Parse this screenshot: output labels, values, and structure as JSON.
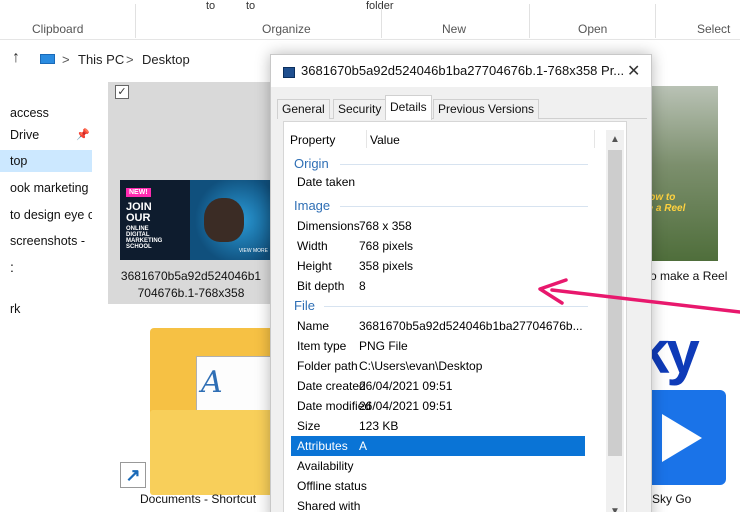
{
  "ribbon": {
    "top_texts": [
      "to",
      "to",
      "folder"
    ],
    "groups": [
      "Clipboard",
      "Organize",
      "New",
      "Open",
      "Select"
    ]
  },
  "address": {
    "crumbs": [
      "This PC",
      "Desktop"
    ],
    "separator": ">"
  },
  "nav": {
    "items": [
      "access",
      "Drive",
      "top",
      "ook marketing",
      "to design eye c",
      "screenshots -",
      "",
      "rk"
    ]
  },
  "files": {
    "selected_name_line1": "3681670b5a92d524046b1",
    "selected_name_line2": "704676b.1-768x358",
    "thumb_text": {
      "new": "NEW!",
      "join": "JOIN\nOUR",
      "small": "ONLINE\nDIGITAL\nMARKETING\nSCHOOL",
      "more": "VIEW MORE"
    },
    "right_thumb_text": "How to\nke a Reel",
    "right_name": "o make a Reel",
    "folder_name": "Documents - Shortcut",
    "sky_text": "ky",
    "skygo_name": "Sky Go"
  },
  "dialog": {
    "title": "3681670b5a92d524046b1ba27704676b.1-768x358 Pr...",
    "close_glyph": "✕",
    "tabs": [
      "General",
      "Security",
      "Details",
      "Previous Versions"
    ],
    "active_tab": "Details",
    "header": {
      "property": "Property",
      "value": "Value"
    },
    "groups": {
      "origin": "Origin",
      "image": "Image",
      "file": "File"
    },
    "origin_rows": [
      {
        "key": "Date taken",
        "value": ""
      }
    ],
    "image_rows": [
      {
        "key": "Dimensions",
        "value": "768 x 358"
      },
      {
        "key": "Width",
        "value": "768 pixels"
      },
      {
        "key": "Height",
        "value": "358 pixels"
      },
      {
        "key": "Bit depth",
        "value": "8"
      }
    ],
    "file_rows": [
      {
        "key": "Name",
        "value": "3681670b5a92d524046b1ba27704676b..."
      },
      {
        "key": "Item type",
        "value": "PNG File"
      },
      {
        "key": "Folder path",
        "value": "C:\\Users\\evan\\Desktop"
      },
      {
        "key": "Date created",
        "value": "26/04/2021 09:51"
      },
      {
        "key": "Date modified",
        "value": "26/04/2021 09:51"
      },
      {
        "key": "Size",
        "value": "123 KB"
      },
      {
        "key": "Attributes",
        "value": "A"
      },
      {
        "key": "Availability",
        "value": ""
      },
      {
        "key": "Offline status",
        "value": ""
      },
      {
        "key": "Shared with",
        "value": ""
      }
    ],
    "selected_row": "Attributes"
  },
  "colors": {
    "selection": "#0a74d6",
    "group_label": "#2f6fb5",
    "annotation_arrow": "#e8186d",
    "nav_selected": "#cce8ff"
  }
}
